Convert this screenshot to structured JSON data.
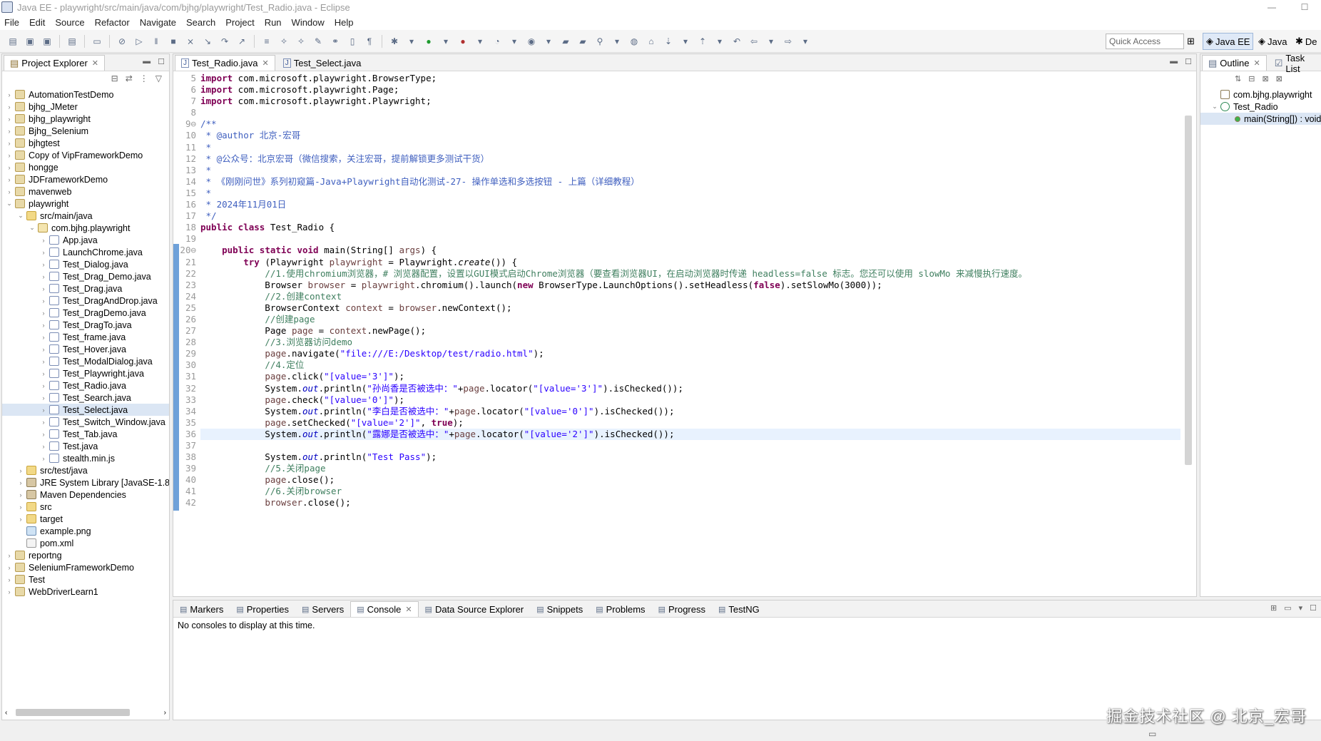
{
  "window": {
    "title": "Java EE - playwright/src/main/java/com/bjhg/playwright/Test_Radio.java - Eclipse"
  },
  "menu": [
    "File",
    "Edit",
    "Source",
    "Refactor",
    "Navigate",
    "Search",
    "Project",
    "Run",
    "Window",
    "Help"
  ],
  "toolbar": {
    "quick_access": "Quick Access"
  },
  "perspectives": [
    "Java EE",
    "Java",
    "De"
  ],
  "project_explorer": {
    "title": "Project Explorer",
    "items": [
      {
        "label": "AutomationTestDemo",
        "depth": 0,
        "icon": "proj",
        "tw": "›"
      },
      {
        "label": "bjhg_JMeter",
        "depth": 0,
        "icon": "proj",
        "tw": "›"
      },
      {
        "label": "bjhg_playwright",
        "depth": 0,
        "icon": "proj",
        "tw": "›"
      },
      {
        "label": "Bjhg_Selenium",
        "depth": 0,
        "icon": "proj",
        "tw": "›"
      },
      {
        "label": "bjhgtest",
        "depth": 0,
        "icon": "proj",
        "tw": "›"
      },
      {
        "label": "Copy of VipFrameworkDemo",
        "depth": 0,
        "icon": "proj",
        "tw": "›"
      },
      {
        "label": "hongge",
        "depth": 0,
        "icon": "proj",
        "tw": "›"
      },
      {
        "label": "JDFrameworkDemo",
        "depth": 0,
        "icon": "proj",
        "tw": "›"
      },
      {
        "label": "mavenweb",
        "depth": 0,
        "icon": "proj",
        "tw": "›"
      },
      {
        "label": "playwright",
        "depth": 0,
        "icon": "proj",
        "tw": "⌄"
      },
      {
        "label": "src/main/java",
        "depth": 1,
        "icon": "folder",
        "tw": "⌄"
      },
      {
        "label": "com.bjhg.playwright",
        "depth": 2,
        "icon": "pkg",
        "tw": "⌄"
      },
      {
        "label": "App.java",
        "depth": 3,
        "icon": "java",
        "tw": "›"
      },
      {
        "label": "LaunchChrome.java",
        "depth": 3,
        "icon": "java",
        "tw": "›"
      },
      {
        "label": "Test_Dialog.java",
        "depth": 3,
        "icon": "java",
        "tw": "›"
      },
      {
        "label": "Test_Drag_Demo.java",
        "depth": 3,
        "icon": "java",
        "tw": "›"
      },
      {
        "label": "Test_Drag.java",
        "depth": 3,
        "icon": "java",
        "tw": "›"
      },
      {
        "label": "Test_DragAndDrop.java",
        "depth": 3,
        "icon": "java",
        "tw": "›"
      },
      {
        "label": "Test_DragDemo.java",
        "depth": 3,
        "icon": "java",
        "tw": "›"
      },
      {
        "label": "Test_DragTo.java",
        "depth": 3,
        "icon": "java",
        "tw": "›"
      },
      {
        "label": "Test_frame.java",
        "depth": 3,
        "icon": "java",
        "tw": "›"
      },
      {
        "label": "Test_Hover.java",
        "depth": 3,
        "icon": "java",
        "tw": "›"
      },
      {
        "label": "Test_ModalDialog.java",
        "depth": 3,
        "icon": "java",
        "tw": "›"
      },
      {
        "label": "Test_Playwright.java",
        "depth": 3,
        "icon": "java",
        "tw": "›"
      },
      {
        "label": "Test_Radio.java",
        "depth": 3,
        "icon": "java",
        "tw": "›"
      },
      {
        "label": "Test_Search.java",
        "depth": 3,
        "icon": "java",
        "tw": "›"
      },
      {
        "label": "Test_Select.java",
        "depth": 3,
        "icon": "java",
        "tw": "›",
        "selected": true
      },
      {
        "label": "Test_Switch_Window.java",
        "depth": 3,
        "icon": "java",
        "tw": "›"
      },
      {
        "label": "Test_Tab.java",
        "depth": 3,
        "icon": "java",
        "tw": "›"
      },
      {
        "label": "Test.java",
        "depth": 3,
        "icon": "java",
        "tw": "›"
      },
      {
        "label": "stealth.min.js",
        "depth": 3,
        "icon": "java",
        "tw": "›"
      },
      {
        "label": "src/test/java",
        "depth": 1,
        "icon": "folder",
        "tw": "›"
      },
      {
        "label": "JRE System Library [JavaSE-1.8]",
        "depth": 1,
        "icon": "lib",
        "tw": "›"
      },
      {
        "label": "Maven Dependencies",
        "depth": 1,
        "icon": "lib",
        "tw": "›"
      },
      {
        "label": "src",
        "depth": 1,
        "icon": "folder",
        "tw": "›"
      },
      {
        "label": "target",
        "depth": 1,
        "icon": "folder",
        "tw": "›"
      },
      {
        "label": "example.png",
        "depth": 1,
        "icon": "img",
        "tw": ""
      },
      {
        "label": "pom.xml",
        "depth": 1,
        "icon": "xml",
        "tw": ""
      },
      {
        "label": "reportng",
        "depth": 0,
        "icon": "proj",
        "tw": "›"
      },
      {
        "label": "SeleniumFrameworkDemo",
        "depth": 0,
        "icon": "proj",
        "tw": "›"
      },
      {
        "label": "Test",
        "depth": 0,
        "icon": "proj",
        "tw": "›"
      },
      {
        "label": "WebDriverLearn1",
        "depth": 0,
        "icon": "proj",
        "tw": "›"
      }
    ]
  },
  "editor": {
    "tabs": [
      {
        "label": "Test_Radio.java",
        "active": true
      },
      {
        "label": "Test_Select.java",
        "active": false
      }
    ],
    "current_line": "36",
    "lines": [
      {
        "n": "5",
        "html": "<span class='kw'>import</span> com.microsoft.playwright.BrowserType;"
      },
      {
        "n": "6",
        "html": "<span class='kw'>import</span> com.microsoft.playwright.Page;"
      },
      {
        "n": "7",
        "html": "<span class='kw'>import</span> com.microsoft.playwright.Playwright;"
      },
      {
        "n": "8",
        "html": ""
      },
      {
        "n": "9⊖",
        "html": "<span class='doc'>/**</span>"
      },
      {
        "n": "10",
        "html": "<span class='doc'> * @author 北京-宏哥</span>"
      },
      {
        "n": "11",
        "html": "<span class='doc'> *</span>"
      },
      {
        "n": "12",
        "html": "<span class='doc'> * @公众号：北京宏哥（微信搜索，关注宏哥，提前解锁更多测试干货）</span>"
      },
      {
        "n": "13",
        "html": "<span class='doc'> *</span>"
      },
      {
        "n": "14",
        "html": "<span class='doc'> * 《刚刚问世》系列初窥篇-Java+Playwright自动化测试-27- 操作单选和多选按钮 - 上篇（详细教程）</span>"
      },
      {
        "n": "15",
        "html": "<span class='doc'> *</span>"
      },
      {
        "n": "16",
        "html": "<span class='doc'> * 2024年11月01日</span>"
      },
      {
        "n": "17",
        "html": "<span class='doc'> */</span>"
      },
      {
        "n": "18",
        "html": "<span class='kw'>public class</span> Test_Radio {"
      },
      {
        "n": "19",
        "html": ""
      },
      {
        "n": "20⊖",
        "html": "    <span class='kw'>public static void</span> main(String[] <span class='var'>args</span>) {"
      },
      {
        "n": "21",
        "html": "        <span class='kw'>try</span> (Playwright <span class='var'>playwright</span> = Playwright.<i>create</i>()) {"
      },
      {
        "n": "22",
        "html": "            <span class='cm'>//1.使用chromium浏览器，# 浏览器配置，设置以GUI模式启动Chrome浏览器（要查看浏览器UI，在启动浏览器时传递 headless=false 标志。您还可以使用 slowMo 来减慢执行速度。</span>"
      },
      {
        "n": "23",
        "html": "            Browser <span class='var'>browser</span> = <span class='var'>playwright</span>.chromium().launch(<span class='kw'>new</span> BrowserType.LaunchOptions().setHeadless(<span class='kw'>false</span>).setSlowMo(3000));"
      },
      {
        "n": "24",
        "html": "            <span class='cm'>//2.创建context</span>"
      },
      {
        "n": "25",
        "html": "            BrowserContext <span class='var'>context</span> = <span class='var'>browser</span>.newContext();"
      },
      {
        "n": "26",
        "html": "            <span class='cm'>//创建page</span>"
      },
      {
        "n": "27",
        "html": "            Page <span class='var'>page</span> = <span class='var'>context</span>.newPage();"
      },
      {
        "n": "28",
        "html": "            <span class='cm'>//3.浏览器访问demo</span>"
      },
      {
        "n": "29",
        "html": "            <span class='var'>page</span>.navigate(<span class='st'>\"file:///E:/Desktop/test/radio.html\"</span>);"
      },
      {
        "n": "30",
        "html": "            <span class='cm'>//4.定位</span>"
      },
      {
        "n": "31",
        "html": "            <span class='var'>page</span>.click(<span class='st'>\"[value='3']\"</span>);"
      },
      {
        "n": "32",
        "html": "            System.<span class='fld'>out</span>.println(<span class='st'>\"孙尚香是否被选中：\"</span>+<span class='var'>page</span>.locator(<span class='st'>\"[value='3']\"</span>).isChecked());"
      },
      {
        "n": "33",
        "html": "            <span class='var'>page</span>.check(<span class='st'>\"[value='0']\"</span>);"
      },
      {
        "n": "34",
        "html": "            System.<span class='fld'>out</span>.println(<span class='st'>\"李白是否被选中：\"</span>+<span class='var'>page</span>.locator(<span class='st'>\"[value='0']\"</span>).isChecked());"
      },
      {
        "n": "35",
        "html": "            <span class='var'>page</span>.setChecked(<span class='st'>\"[value='2']\"</span>, <span class='kw'>true</span>);"
      },
      {
        "n": "36",
        "html": "            System.<span class='fld'>out</span>.println(<span class='st'>\"露娜是否被选中：\"</span>+<span class='var'>page</span>.locator(<span class='st'>\"[value='2']\"</span>).isChecked());"
      },
      {
        "n": "37",
        "html": ""
      },
      {
        "n": "38",
        "html": "            System.<span class='fld'>out</span>.println(<span class='st'>\"Test Pass\"</span>);"
      },
      {
        "n": "39",
        "html": "            <span class='cm'>//5.关闭page</span>"
      },
      {
        "n": "40",
        "html": "            <span class='var'>page</span>.close();"
      },
      {
        "n": "41",
        "html": "            <span class='cm'>//6.关闭browser</span>"
      },
      {
        "n": "42",
        "html": "            <span class='var'>browser</span>.close();"
      }
    ]
  },
  "outline": {
    "tabs": [
      {
        "label": "Outline"
      },
      {
        "label": "Task List"
      }
    ],
    "items": [
      {
        "label": "com.bjhg.playwright",
        "depth": 0,
        "tw": ""
      },
      {
        "label": "Test_Radio",
        "depth": 0,
        "tw": "⌄"
      },
      {
        "label": "main(String[]) : void",
        "depth": 1,
        "tw": ""
      }
    ]
  },
  "bottom": {
    "tabs": [
      {
        "label": "Markers",
        "active": false
      },
      {
        "label": "Properties",
        "active": false
      },
      {
        "label": "Servers",
        "active": false
      },
      {
        "label": "Console",
        "active": true
      },
      {
        "label": "Data Source Explorer",
        "active": false
      },
      {
        "label": "Snippets",
        "active": false
      },
      {
        "label": "Problems",
        "active": false
      },
      {
        "label": "Progress",
        "active": false
      },
      {
        "label": "TestNG",
        "active": false
      }
    ],
    "console_message": "No consoles to display at this time."
  },
  "watermark": "掘金技术社区 @ 北京_宏哥"
}
